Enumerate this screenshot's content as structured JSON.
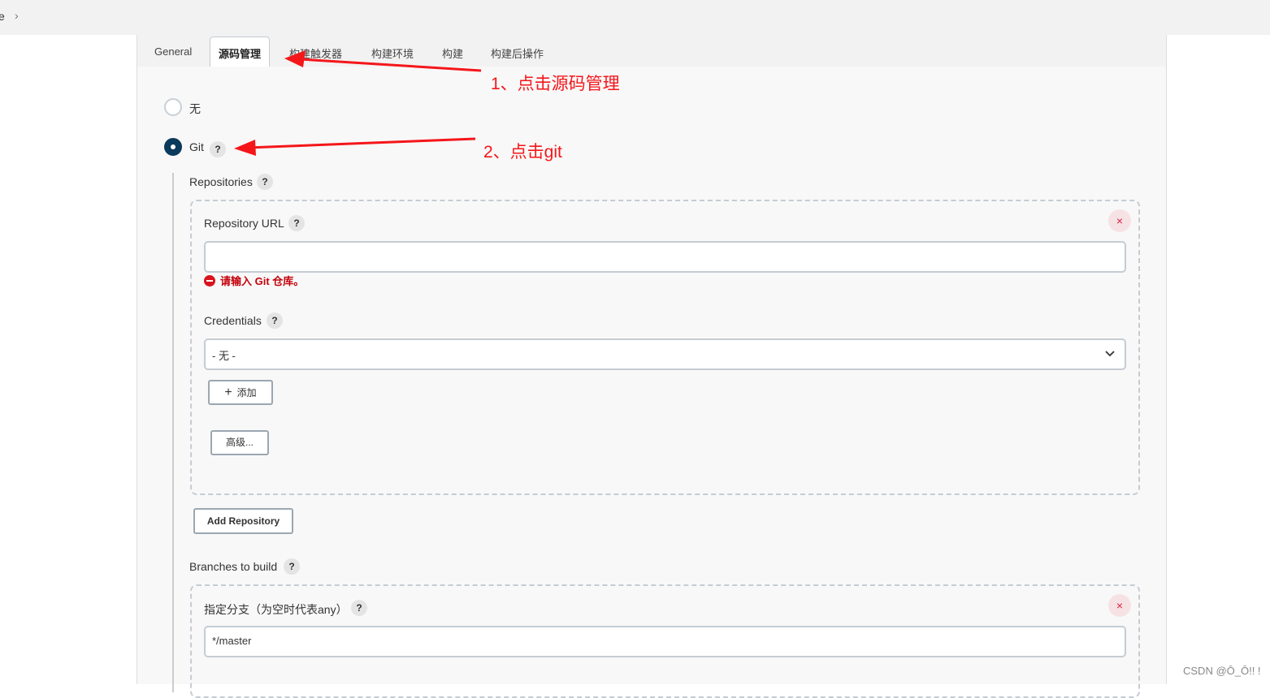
{
  "breadcrumb": {
    "partial": "e",
    "separator": "›"
  },
  "tabs": [
    {
      "label": "General"
    },
    {
      "label": "源码管理",
      "active": true
    },
    {
      "label": "构建触发器"
    },
    {
      "label": "构建环境"
    },
    {
      "label": "构建"
    },
    {
      "label": "构建后操作"
    }
  ],
  "scm": {
    "none_label": "无",
    "git_label": "Git",
    "selected": "Git",
    "help": "?"
  },
  "repositories": {
    "label": "Repositories",
    "url_label": "Repository URL",
    "url_value": "",
    "url_error": "请输入 Git 仓库。",
    "credentials_label": "Credentials",
    "credentials_value": "- 无 -",
    "add_label": "添加",
    "advanced_label": "高级...",
    "add_repo_label": "Add Repository",
    "delete": "×"
  },
  "branches": {
    "label": "Branches to build",
    "spec_label": "指定分支（为空时代表any）",
    "spec_value": "*/master"
  },
  "annotations": {
    "step1": "1、点击源码管理",
    "step2": "2、点击git",
    "color": "#f5161a"
  },
  "watermark": "CSDN @Ō_Ō!! !"
}
